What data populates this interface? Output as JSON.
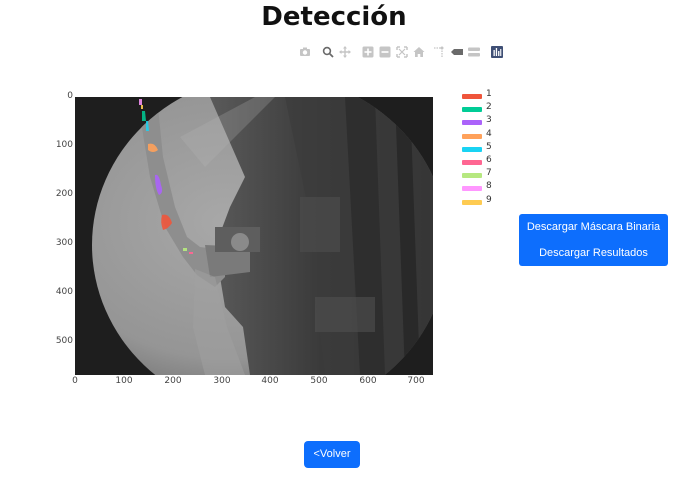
{
  "page": {
    "title": "Detección"
  },
  "toolbar": {
    "buttons": [
      {
        "name": "camera-icon"
      },
      {
        "name": "zoom-icon"
      },
      {
        "name": "pan-icon"
      },
      {
        "name": "zoom-in-icon"
      },
      {
        "name": "zoom-out-icon"
      },
      {
        "name": "autoscale-icon"
      },
      {
        "name": "home-icon"
      },
      {
        "name": "spike-lines-icon"
      },
      {
        "name": "hover-closest-icon"
      },
      {
        "name": "hover-compare-icon"
      },
      {
        "name": "plotly-logo-icon"
      }
    ]
  },
  "plot": {
    "y_ticks": [
      "0",
      "100",
      "200",
      "300",
      "400",
      "500"
    ],
    "x_ticks": [
      "0",
      "100",
      "200",
      "300",
      "400",
      "500",
      "600",
      "700"
    ],
    "legend": [
      {
        "label": "1",
        "color": "#ef553b"
      },
      {
        "label": "2",
        "color": "#00cc96"
      },
      {
        "label": "3",
        "color": "#ab63fa"
      },
      {
        "label": "4",
        "color": "#ffa15a"
      },
      {
        "label": "5",
        "color": "#19d3f3"
      },
      {
        "label": "6",
        "color": "#ff6692"
      },
      {
        "label": "7",
        "color": "#b6e880"
      },
      {
        "label": "8",
        "color": "#ff97ff"
      },
      {
        "label": "9",
        "color": "#fecb52"
      }
    ]
  },
  "actions": {
    "download_mask": "Descargar Máscara Binaria",
    "download_results": "Descargar Resultados",
    "back": "<Volver"
  }
}
